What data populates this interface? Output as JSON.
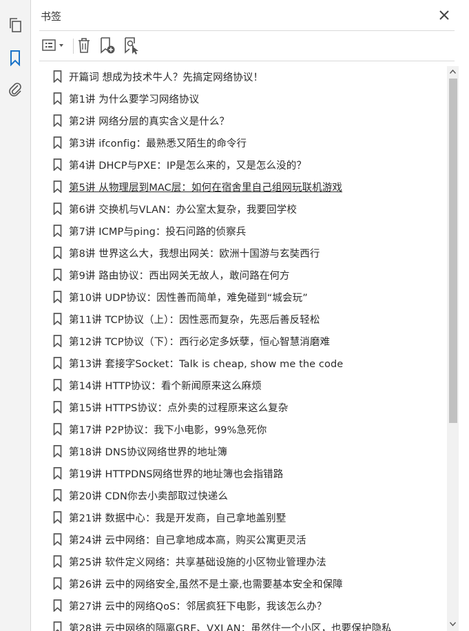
{
  "panel": {
    "title": "书签"
  },
  "toolbar": {
    "options": "list-options-icon",
    "delete": "trash-icon",
    "new": "new-bookmark-icon",
    "find": "find-bookmark-icon"
  },
  "bookmarks": [
    {
      "label": "开篇词  想成为技术牛人？先搞定网络协议！"
    },
    {
      "label": "第1讲 为什么要学习网络协议"
    },
    {
      "label": "第2讲 网络分层的真实含义是什么？"
    },
    {
      "label": "第3讲 ifconfig：最熟悉又陌生的命令行"
    },
    {
      "label": "第4讲 DHCP与PXE：IP是怎么来的，又是怎么没的？"
    },
    {
      "label": "第5讲 从物理层到MAC层：如何在宿舍里自己组网玩联机游戏"
    },
    {
      "label": "第6讲 交换机与VLAN：办公室太复杂，我要回学校"
    },
    {
      "label": "第7讲 ICMP与ping：投石问路的侦察兵"
    },
    {
      "label": "第8讲 世界这么大，我想出网关：欧洲十国游与玄奘西行"
    },
    {
      "label": "第9讲 路由协议：西出网关无故人，敢问路在何方"
    },
    {
      "label": "第10讲 UDP协议：因性善而简单，难免碰到“城会玩”"
    },
    {
      "label": "第11讲 TCP协议（上）：因性恶而复杂，先恶后善反轻松"
    },
    {
      "label": "第12讲 TCP协议（下）：西行必定多妖孽，恒心智慧消磨难"
    },
    {
      "label": "第13讲 套接字Socket：Talk is cheap, show me the code"
    },
    {
      "label": "第14讲 HTTP协议：看个新闻原来这么麻烦"
    },
    {
      "label": "第15讲 HTTPS协议：点外卖的过程原来这么复杂"
    },
    {
      "label": "第17讲 P2P协议：我下小电影，99%急死你"
    },
    {
      "label": "第18讲 DNS协议网络世界的地址簿"
    },
    {
      "label": "第19讲 HTTPDNS网络世界的地址簿也会指错路"
    },
    {
      "label": "第20讲 CDN你去小卖部取过快递么"
    },
    {
      "label": "第21讲 数据中心：我是开发商，自己拿地盖别墅"
    },
    {
      "label": "第24讲 云中网络：自己拿地成本高，购买公寓更灵活"
    },
    {
      "label": "第25讲 软件定义网络：共享基础设施的小区物业管理办法"
    },
    {
      "label": "第26讲 云中的网络安全,虽然不是土豪,也需要基本安全和保障"
    },
    {
      "label": "第27讲 云中的网络QoS：邻居疯狂下电影，我该怎么办？"
    },
    {
      "label": "第28讲 云中网络的隔离GRE、VXLAN：虽然住一个小区，也要保护隐私"
    }
  ],
  "active_index": 5
}
